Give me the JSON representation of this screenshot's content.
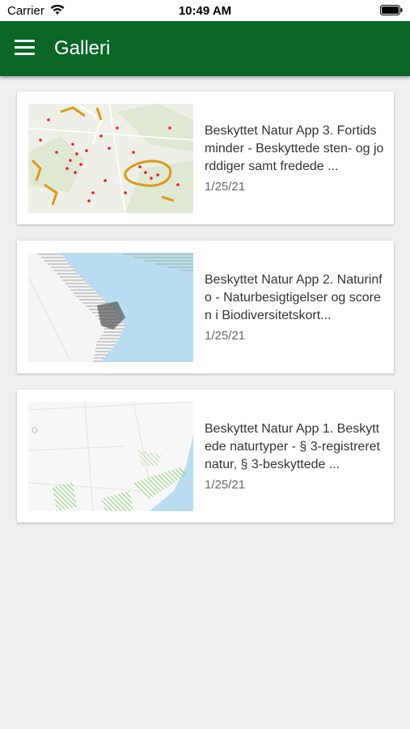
{
  "status_bar": {
    "carrier": "Carrier",
    "time": "10:49 AM"
  },
  "app_bar": {
    "title": "Galleri",
    "menu_icon": "hamburger-menu-icon"
  },
  "colors": {
    "primary": "#0b6627",
    "background": "#efefef",
    "card": "#ffffff"
  },
  "gallery": {
    "items": [
      {
        "title": "Beskyttet Natur App 3. Fortidsminder - Beskyttede sten- og jorddiger samt fredede ...",
        "date": "1/25/21"
      },
      {
        "title": "Beskyttet Natur App 2. Naturinfo - Naturbesigtigelser og scoren i Biodiversitetskort...",
        "date": "1/25/21"
      },
      {
        "title": "Beskyttet Natur App 1. Beskyttede naturtyper - § 3-registreret natur, § 3-beskyttede ...",
        "date": "1/25/21"
      }
    ]
  }
}
